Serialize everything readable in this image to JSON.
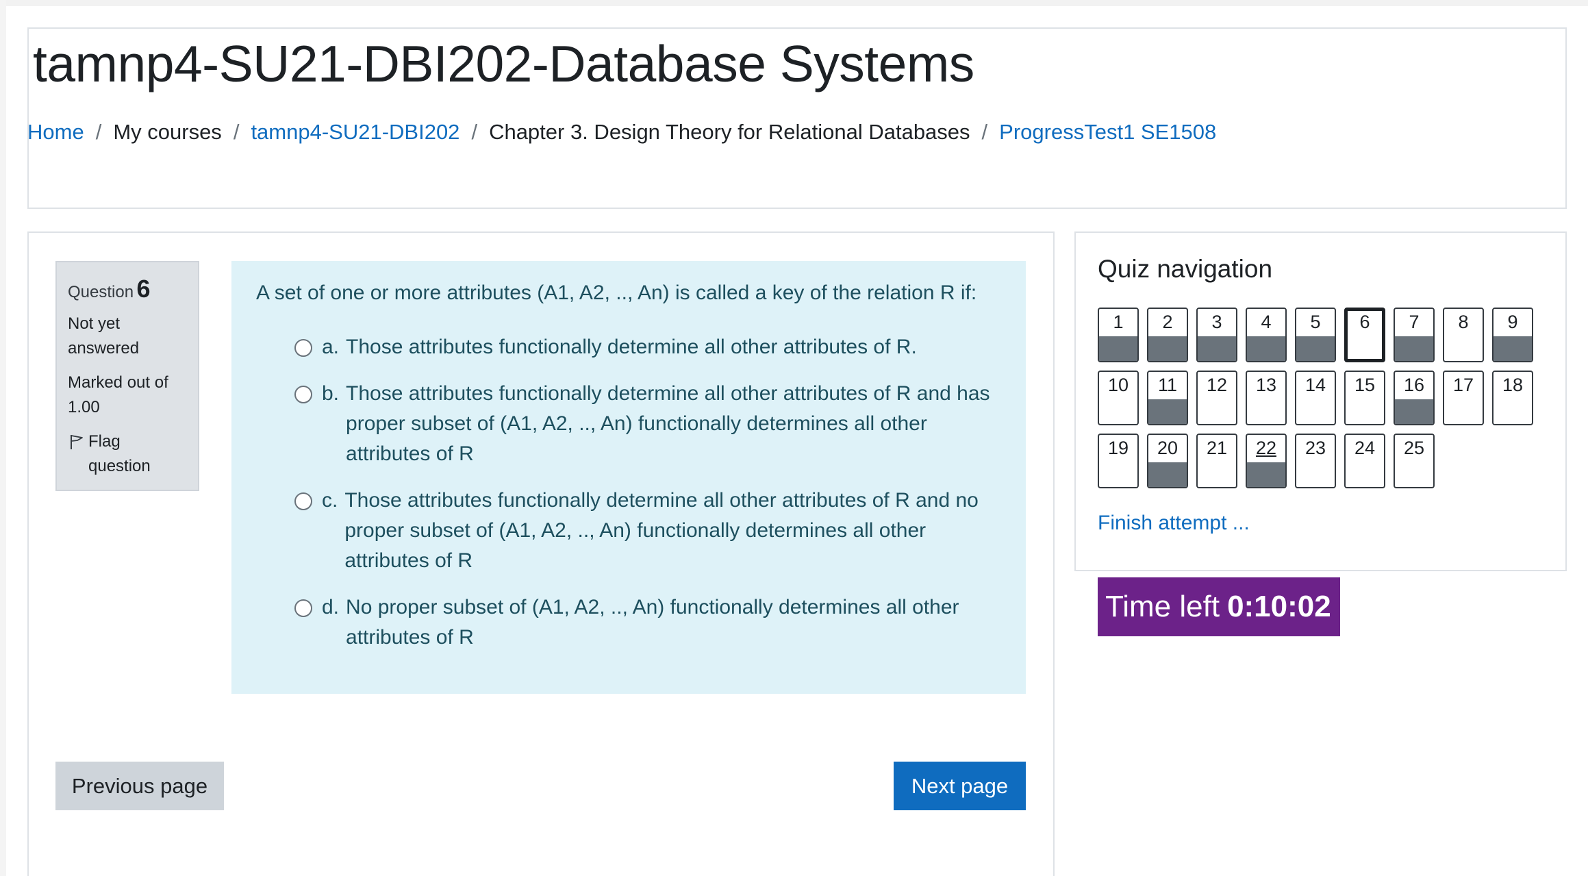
{
  "header": {
    "title": "tamnp4-SU21-DBI202-Database Systems",
    "breadcrumb": [
      {
        "label": "Home",
        "link": true
      },
      {
        "label": "My courses",
        "link": false
      },
      {
        "label": "tamnp4-SU21-DBI202",
        "link": true
      },
      {
        "label": "Chapter 3. Design Theory for Relational Databases",
        "link": false
      },
      {
        "label": "ProgressTest1 SE1508",
        "link": true
      }
    ]
  },
  "question_info": {
    "label": "Question",
    "number": "6",
    "state": "Not yet answered",
    "grade": "Marked out of 1.00",
    "flag": "Flag question"
  },
  "question": {
    "text": "A set of one or more attributes (A1, A2, .., An) is called a key of the relation R if:",
    "answers": [
      {
        "letter": "a.",
        "text": "Those attributes functionally determine all other attributes of R."
      },
      {
        "letter": "b.",
        "text": "Those attributes functionally determine all other attributes of R and has proper subset of (A1, A2, .., An) functionally determines all other attributes of R"
      },
      {
        "letter": "c.",
        "text": "Those attributes functionally determine all other attributes of R and no proper subset of (A1, A2, .., An) functionally determines all other attributes of R"
      },
      {
        "letter": "d.",
        "text": "No proper subset of (A1, A2, .., An) functionally determines all other attributes of R"
      }
    ]
  },
  "buttons": {
    "previous": "Previous page",
    "next": "Next page"
  },
  "quiz_nav": {
    "title": "Quiz navigation",
    "questions": [
      {
        "n": "1",
        "answered": true
      },
      {
        "n": "2",
        "answered": true
      },
      {
        "n": "3",
        "answered": true
      },
      {
        "n": "4",
        "answered": true
      },
      {
        "n": "5",
        "answered": true
      },
      {
        "n": "6",
        "answered": false,
        "current": true
      },
      {
        "n": "7",
        "answered": true
      },
      {
        "n": "8",
        "answered": false
      },
      {
        "n": "9",
        "answered": true
      },
      {
        "n": "10",
        "answered": false
      },
      {
        "n": "11",
        "answered": true
      },
      {
        "n": "12",
        "answered": false
      },
      {
        "n": "13",
        "answered": false
      },
      {
        "n": "14",
        "answered": false
      },
      {
        "n": "15",
        "answered": false
      },
      {
        "n": "16",
        "answered": true
      },
      {
        "n": "17",
        "answered": false
      },
      {
        "n": "18",
        "answered": false
      },
      {
        "n": "19",
        "answered": false
      },
      {
        "n": "20",
        "answered": true
      },
      {
        "n": "21",
        "answered": false
      },
      {
        "n": "22",
        "answered": true,
        "underlined": true
      },
      {
        "n": "23",
        "answered": false
      },
      {
        "n": "24",
        "answered": false
      },
      {
        "n": "25",
        "answered": false
      }
    ],
    "finish": "Finish attempt ..."
  },
  "timer": {
    "label": "Time left",
    "value": "0:10:02"
  },
  "colors": {
    "link": "#0f6cbf",
    "answered_fill": "#6a737b",
    "timer_bg": "#6c2289",
    "question_bg": "#def2f8"
  }
}
